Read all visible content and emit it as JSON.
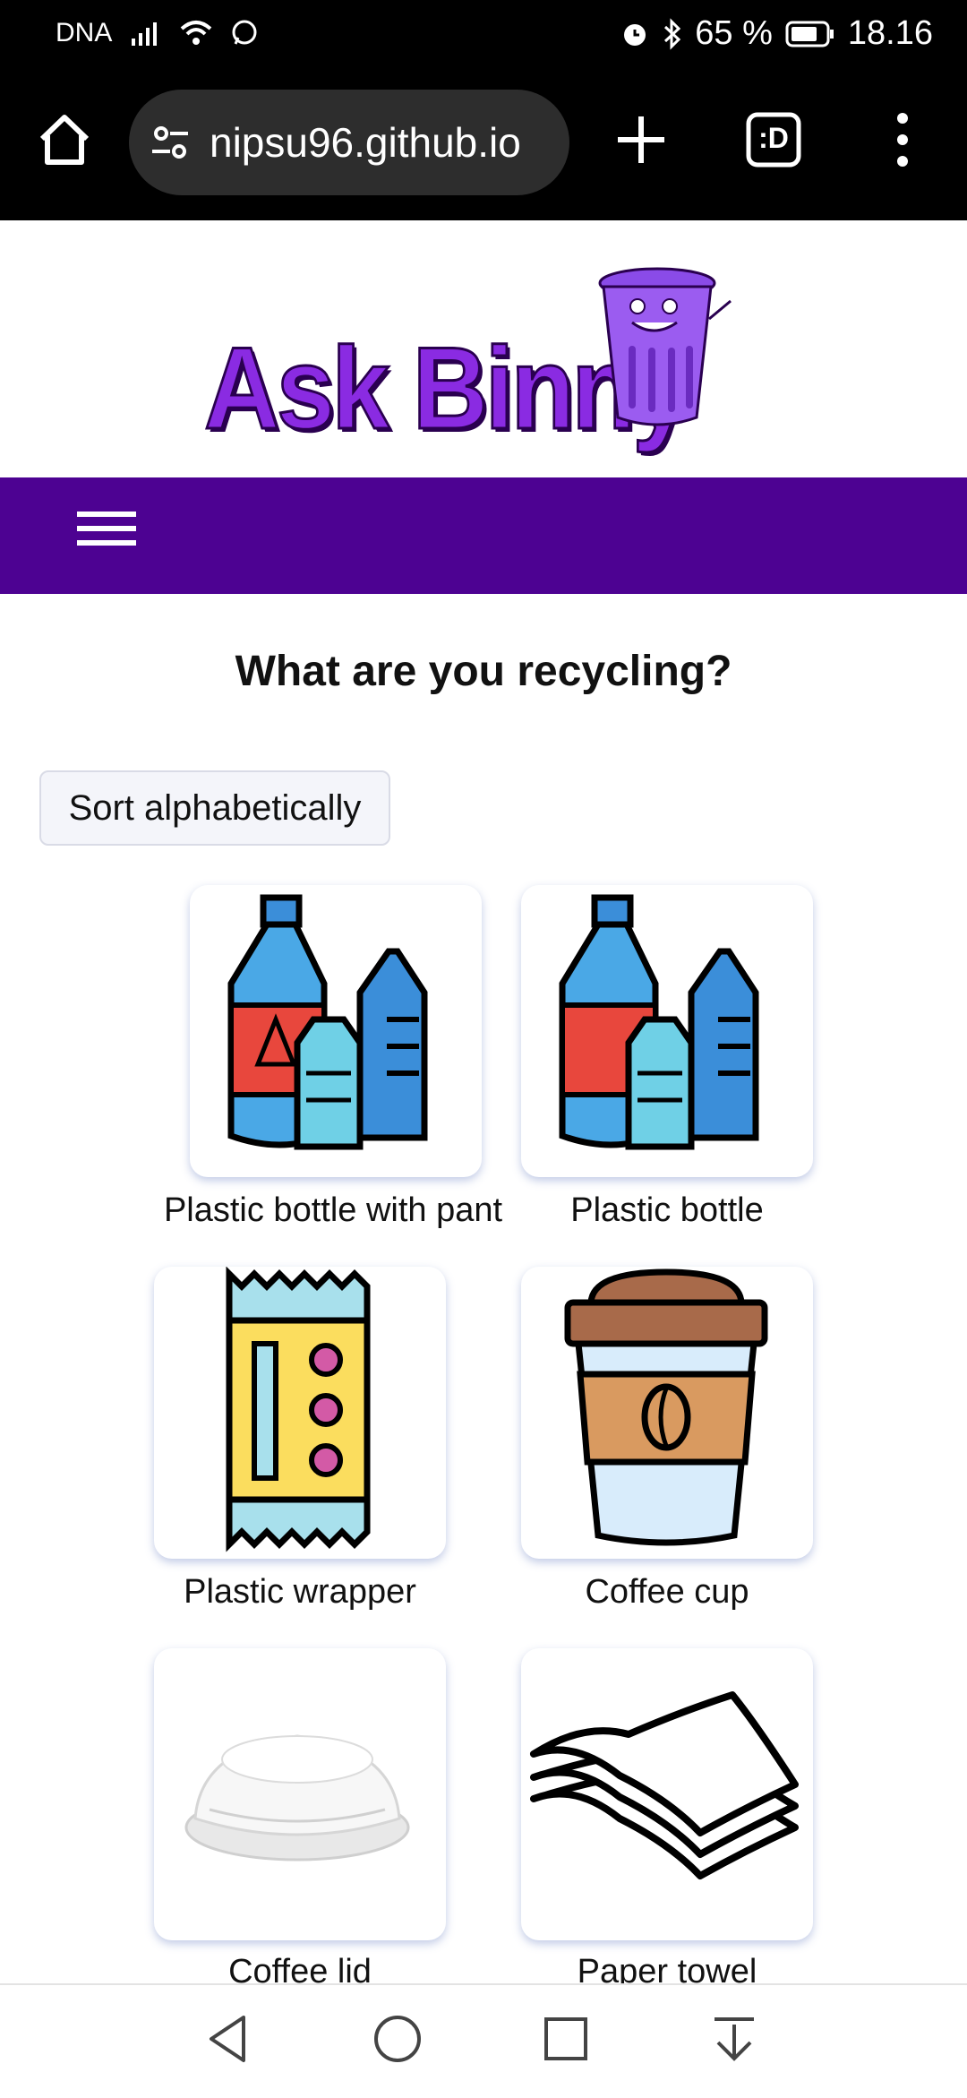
{
  "status_bar": {
    "carrier": "DNA",
    "battery": "65 %",
    "time": "18.16",
    "icons": [
      "signal-icon",
      "wifi-icon",
      "whatsapp-icon",
      "alarm-icon",
      "bluetooth-icon",
      "battery-icon"
    ]
  },
  "browser": {
    "url": "nipsu96.github.io",
    "tabs_face": ":D",
    "icons": [
      "home-icon",
      "site-settings-icon",
      "plus-icon",
      "tabs-icon",
      "more-icon"
    ]
  },
  "site": {
    "logo_text": "Ask Binny",
    "brand_color": "#4d0292",
    "logo_color": "#8a2be2"
  },
  "main": {
    "heading": "What are you recycling?",
    "sort_button": "Sort alphabetically",
    "items": [
      {
        "label": "Plastic bottle with pant",
        "icon": "plastic-bottle-pant-icon"
      },
      {
        "label": "Plastic bottle",
        "icon": "plastic-bottle-icon"
      },
      {
        "label": "Plastic wrapper",
        "icon": "plastic-wrapper-icon"
      },
      {
        "label": "Coffee cup",
        "icon": "coffee-cup-icon"
      },
      {
        "label": "Coffee lid",
        "icon": "coffee-lid-icon"
      },
      {
        "label": "Paper towel",
        "icon": "paper-towel-icon"
      }
    ]
  },
  "system_nav": {
    "icons": [
      "back-icon",
      "home-circle-icon",
      "recents-icon",
      "notifications-down-icon"
    ]
  }
}
